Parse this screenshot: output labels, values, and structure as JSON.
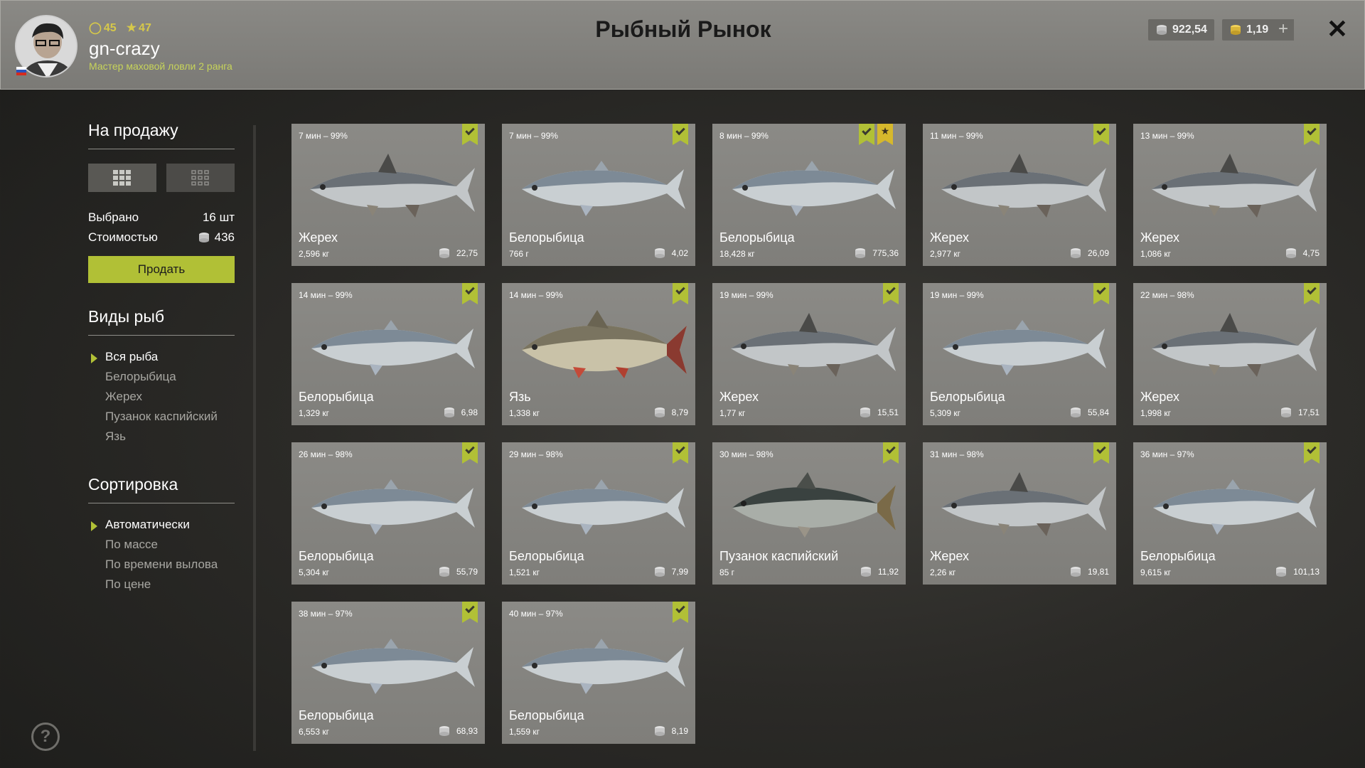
{
  "header": {
    "title": "Рыбный Рынок",
    "level": "45",
    "stars": "47",
    "username": "gn-crazy",
    "rank": "Мастер маховой ловли 2 ранга",
    "silver": "922,54",
    "gold": "1,19",
    "plus": "+",
    "close": "✕"
  },
  "sidebar": {
    "sale_title": "На продажу",
    "selected_label": "Выбрано",
    "selected_value": "16 шт",
    "cost_label": "Стоимостью",
    "cost_value": "436",
    "sell_label": "Продать",
    "species_title": "Виды рыб",
    "species": [
      "Вся рыба",
      "Белорыбица",
      "Жерех",
      "Пузанок каспийский",
      "Язь"
    ],
    "sort_title": "Сортировка",
    "sort": [
      "Автоматически",
      "По массе",
      "По времени вылова",
      "По цене"
    ],
    "help": "?"
  },
  "colors": {
    "accent": "#b1c036",
    "gold": "#d6b82c",
    "rank": "#c7d45a"
  },
  "cards": [
    {
      "time": "7 мин – 99%",
      "name": "Жерех",
      "weight": "2,596 кг",
      "price": "22,75",
      "kind": "asp",
      "star": false
    },
    {
      "time": "7 мин – 99%",
      "name": "Белорыбица",
      "weight": "766 г",
      "price": "4,02",
      "kind": "whitefish",
      "star": false
    },
    {
      "time": "8 мин – 99%",
      "name": "Белорыбица",
      "weight": "18,428 кг",
      "price": "775,36",
      "kind": "whitefish",
      "star": true
    },
    {
      "time": "11 мин – 99%",
      "name": "Жерех",
      "weight": "2,977 кг",
      "price": "26,09",
      "kind": "asp",
      "star": false
    },
    {
      "time": "13 мин – 99%",
      "name": "Жерех",
      "weight": "1,086 кг",
      "price": "4,75",
      "kind": "asp",
      "star": false
    },
    {
      "time": "14 мин – 99%",
      "name": "Белорыбица",
      "weight": "1,329 кг",
      "price": "6,98",
      "kind": "whitefish",
      "star": false
    },
    {
      "time": "14 мин – 99%",
      "name": "Язь",
      "weight": "1,338 кг",
      "price": "8,79",
      "kind": "ide",
      "star": false
    },
    {
      "time": "19 мин – 99%",
      "name": "Жерех",
      "weight": "1,77 кг",
      "price": "15,51",
      "kind": "asp",
      "star": false
    },
    {
      "time": "19 мин – 99%",
      "name": "Белорыбица",
      "weight": "5,309 кг",
      "price": "55,84",
      "kind": "whitefish",
      "star": false
    },
    {
      "time": "22 мин – 98%",
      "name": "Жерех",
      "weight": "1,998 кг",
      "price": "17,51",
      "kind": "asp",
      "star": false
    },
    {
      "time": "26 мин – 98%",
      "name": "Белорыбица",
      "weight": "5,304 кг",
      "price": "55,79",
      "kind": "whitefish",
      "star": false
    },
    {
      "time": "29 мин – 98%",
      "name": "Белорыбица",
      "weight": "1,521 кг",
      "price": "7,99",
      "kind": "whitefish",
      "star": false
    },
    {
      "time": "30 мин – 98%",
      "name": "Пузанок каспийский",
      "weight": "85 г",
      "price": "11,92",
      "kind": "shad",
      "star": false
    },
    {
      "time": "31 мин – 98%",
      "name": "Жерех",
      "weight": "2,26 кг",
      "price": "19,81",
      "kind": "asp",
      "star": false
    },
    {
      "time": "36 мин – 97%",
      "name": "Белорыбица",
      "weight": "9,615 кг",
      "price": "101,13",
      "kind": "whitefish",
      "star": false
    },
    {
      "time": "38 мин – 97%",
      "name": "Белорыбица",
      "weight": "6,553 кг",
      "price": "68,93",
      "kind": "whitefish",
      "star": false
    },
    {
      "time": "40 мин – 97%",
      "name": "Белорыбица",
      "weight": "1,559 кг",
      "price": "8,19",
      "kind": "whitefish",
      "star": false
    }
  ]
}
